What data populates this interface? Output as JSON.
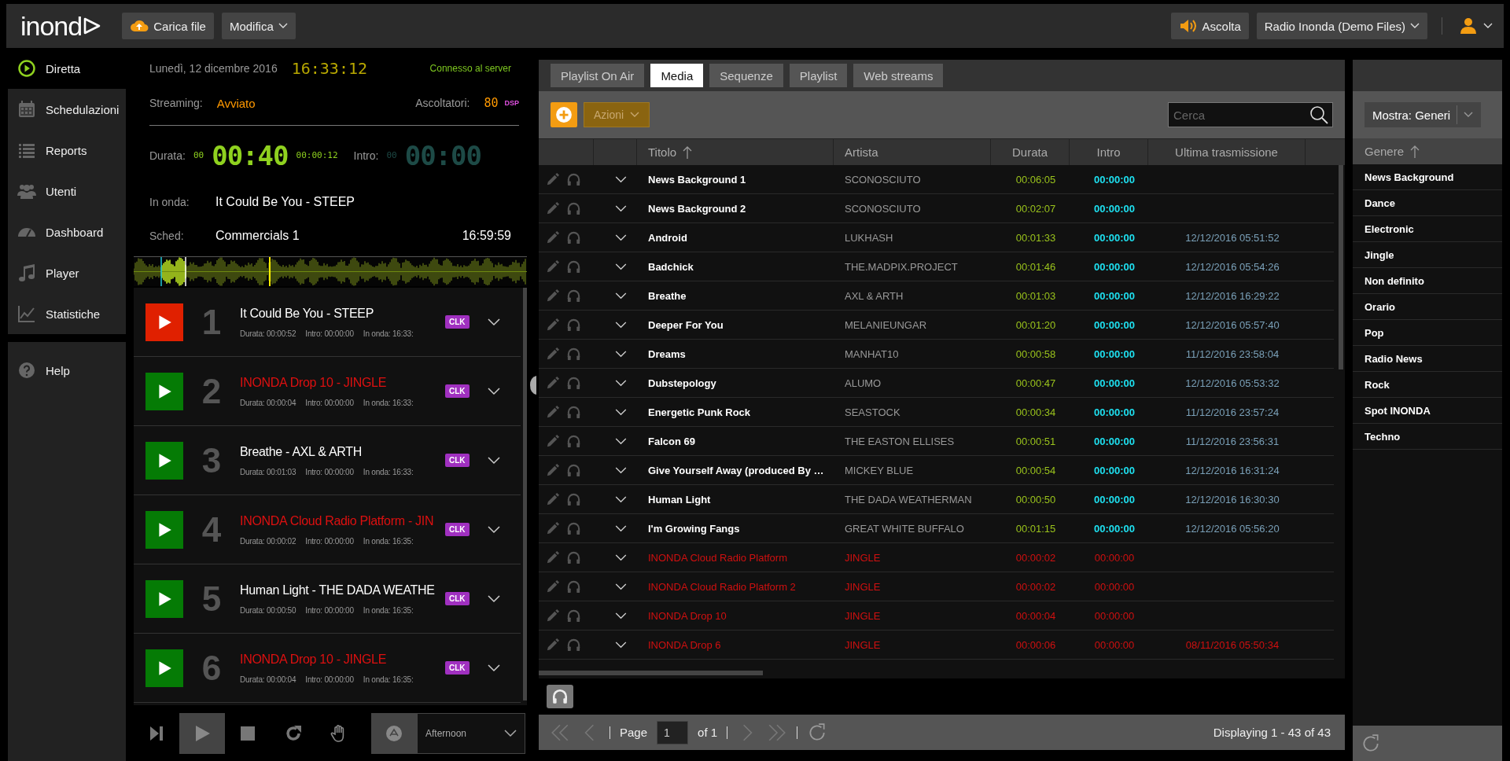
{
  "topbar": {
    "logo": "inond",
    "upload_button": "Carica file",
    "edit_menu": "Modifica",
    "listen_button": "Ascolta",
    "station_menu": "Radio Inonda (Demo Files)"
  },
  "nav": {
    "items": [
      {
        "label": "Diretta",
        "selected": true
      },
      {
        "label": "Schedulazioni",
        "selected": false
      },
      {
        "label": "Reports",
        "selected": false
      },
      {
        "label": "Utenti",
        "selected": false
      },
      {
        "label": "Dashboard",
        "selected": false
      },
      {
        "label": "Player",
        "selected": false
      },
      {
        "label": "Statistiche",
        "selected": false
      }
    ],
    "help": "Help"
  },
  "onair": {
    "date": "Lunedì, 12 dicembre 2016",
    "clock": "16:33:12",
    "connection": "Connesso al server",
    "streaming_label": "Streaming:",
    "streaming_status": "Avviato",
    "listeners_label": "Ascoltatori:",
    "listeners": "80",
    "dsp": "DSP",
    "duration_label": "Durata:",
    "duration_hours": "00",
    "duration": "00:40",
    "elapsed": "00:00:12",
    "intro_label": "Intro:",
    "intro_hours": "00",
    "intro": "00:00",
    "on_air_label": "In onda:",
    "on_air_title": "It Could Be You - STEEP",
    "sched_label": "Sched:",
    "sched_title": "Commercials 1",
    "sched_time": "16:59:59"
  },
  "playlist": [
    {
      "number": "1",
      "title": "It Could Be You - STEEP",
      "kind": "music",
      "playing": true,
      "duration": "Durata: 00:00:52",
      "intro": "Intro: 00:00:00",
      "on_air": "In onda: 16:33:",
      "badge": "CLK"
    },
    {
      "number": "2",
      "title": "INONDA Drop 10 - JINGLE",
      "kind": "jingle",
      "playing": false,
      "duration": "Durata: 00:00:04",
      "intro": "Intro: 00:00:00",
      "on_air": "In onda: 16:33:",
      "badge": "CLK"
    },
    {
      "number": "3",
      "title": "Breathe - AXL & ARTH",
      "kind": "music",
      "playing": false,
      "duration": "Durata: 00:01:03",
      "intro": "Intro: 00:00:00",
      "on_air": "In onda: 16:33:",
      "badge": "CLK"
    },
    {
      "number": "4",
      "title": "INONDA Cloud Radio Platform - JIN",
      "kind": "jingle",
      "playing": false,
      "duration": "Durata: 00:00:02",
      "intro": "Intro: 00:00:00",
      "on_air": "In onda: 16:35:",
      "badge": "CLK"
    },
    {
      "number": "5",
      "title": "Human Light - THE DADA WEATHE",
      "kind": "music",
      "playing": false,
      "duration": "Durata: 00:00:50",
      "intro": "Intro: 00:00:00",
      "on_air": "In onda: 16:35:",
      "badge": "CLK"
    },
    {
      "number": "6",
      "title": "INONDA Drop 10 - JINGLE",
      "kind": "jingle",
      "playing": false,
      "duration": "Durata: 00:00:04",
      "intro": "Intro: 00:00:00",
      "on_air": "In onda: 16:35:",
      "badge": "CLK"
    }
  ],
  "transport": {
    "play_selected": true,
    "schedule_menu": "Afternoon"
  },
  "tabs": [
    {
      "label": "Playlist On Air",
      "selected": false
    },
    {
      "label": "Media",
      "selected": true
    },
    {
      "label": "Sequenze",
      "selected": false
    },
    {
      "label": "Playlist",
      "selected": false
    },
    {
      "label": "Web streams",
      "selected": false
    }
  ],
  "toolbar": {
    "actions_menu": "Azioni",
    "search": {
      "placeholder": "Cerca"
    }
  },
  "table": {
    "columns": [
      "Titolo",
      "Artista",
      "Durata",
      "Intro",
      "Ultima trasmissione"
    ],
    "rows": [
      {
        "kind": "music",
        "title": "News Background 1",
        "artist": "SCONOSCIUTO",
        "duration": "00:06:05",
        "intro": "00:00:00"
      },
      {
        "kind": "music",
        "title": "News Background 2",
        "artist": "SCONOSCIUTO",
        "duration": "00:02:07",
        "intro": "00:00:00"
      },
      {
        "kind": "music",
        "title": "Android",
        "artist": "LUKHASH",
        "duration": "00:01:33",
        "intro": "00:00:00",
        "last": "12/12/2016 05:51:52"
      },
      {
        "kind": "music",
        "title": "Badchick",
        "artist": "THE.MADPIX.PROJECT",
        "duration": "00:01:46",
        "intro": "00:00:00",
        "last": "12/12/2016 05:54:26"
      },
      {
        "kind": "music",
        "title": "Breathe",
        "artist": "AXL & ARTH",
        "duration": "00:01:03",
        "intro": "00:00:00",
        "last": "12/12/2016 16:29:22"
      },
      {
        "kind": "music",
        "title": "Deeper For You",
        "artist": "MELANIEUNGAR",
        "duration": "00:01:20",
        "intro": "00:00:00",
        "last": "12/12/2016 05:57:40"
      },
      {
        "kind": "music",
        "title": "Dreams",
        "artist": "MANHAT10",
        "duration": "00:00:58",
        "intro": "00:00:00",
        "last": "11/12/2016 23:58:04"
      },
      {
        "kind": "music",
        "title": "Dubstepology",
        "artist": "ALUMO",
        "duration": "00:00:47",
        "intro": "00:00:00",
        "last": "12/12/2016 05:53:32"
      },
      {
        "kind": "music",
        "title": "Energetic Punk Rock",
        "artist": "SEASTOCK",
        "duration": "00:00:34",
        "intro": "00:00:00",
        "last": "11/12/2016 23:57:24"
      },
      {
        "kind": "music",
        "title": "Falcon 69",
        "artist": "THE EASTON ELLISES",
        "duration": "00:00:51",
        "intro": "00:00:00",
        "last": "11/12/2016 23:56:31"
      },
      {
        "kind": "music",
        "title": "Give Yourself Away (produced By …",
        "artist": "MICKEY BLUE",
        "duration": "00:00:54",
        "intro": "00:00:00",
        "last": "12/12/2016 16:31:24"
      },
      {
        "kind": "music",
        "title": "Human Light",
        "artist": "THE DADA WEATHERMAN",
        "duration": "00:00:50",
        "intro": "00:00:00",
        "last": "12/12/2016 16:30:30"
      },
      {
        "kind": "music",
        "title": "I'm Growing Fangs",
        "artist": "GREAT WHITE BUFFALO",
        "duration": "00:01:15",
        "intro": "00:00:00",
        "last": "12/12/2016 05:56:20"
      },
      {
        "kind": "jingle",
        "title": "INONDA Cloud Radio Platform",
        "artist": "JINGLE",
        "duration": "00:00:02",
        "intro": "00:00:00"
      },
      {
        "kind": "jingle",
        "title": "INONDA Cloud Radio Platform 2",
        "artist": "JINGLE",
        "duration": "00:00:02",
        "intro": "00:00:00"
      },
      {
        "kind": "jingle",
        "title": "INONDA Drop 10",
        "artist": "JINGLE",
        "duration": "00:00:04",
        "intro": "00:00:00"
      },
      {
        "kind": "jingle",
        "title": "INONDA Drop 6",
        "artist": "JINGLE",
        "duration": "00:00:06",
        "intro": "00:00:00",
        "last": "08/11/2016 05:50:34"
      }
    ]
  },
  "pager": {
    "page_label": "Page",
    "page": "1",
    "of": "of 1",
    "summary": "Displaying 1 - 43 of 43"
  },
  "genres": {
    "menu": "Mostra: Generi",
    "column": "Genere",
    "items": [
      {
        "label": "News Background"
      },
      {
        "label": "Dance"
      },
      {
        "label": "Electronic"
      },
      {
        "label": "Jingle"
      },
      {
        "label": "Non definito"
      },
      {
        "label": "Orario"
      },
      {
        "label": "Pop"
      },
      {
        "label": "Radio News"
      },
      {
        "label": "Rock"
      },
      {
        "label": "Spot INONDA"
      },
      {
        "label": "Techno"
      }
    ]
  }
}
